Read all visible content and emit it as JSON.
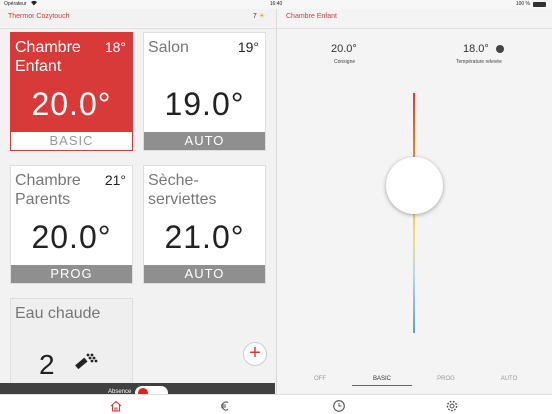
{
  "status": {
    "carrier": "Opérateur",
    "time": "16:40",
    "battery": "100 %"
  },
  "left_nav": {
    "title": "Thermor Cozytouch",
    "weather": "7"
  },
  "tiles": [
    {
      "name": "Chambre Enfant",
      "room_temp": "18°",
      "setpoint": "20.0°",
      "mode": "BASIC"
    },
    {
      "name": "Salon",
      "room_temp": "19°",
      "setpoint": "19.0°",
      "mode": "AUTO"
    },
    {
      "name": "Chambre Parents",
      "room_temp": "21°",
      "setpoint": "20.0°",
      "mode": "PROG"
    },
    {
      "name": "Sèche-serviettes",
      "room_temp": "",
      "setpoint": "21.0°",
      "mode": "AUTO"
    },
    {
      "name": "Eau chaude",
      "value": "2"
    }
  ],
  "add_label": "+",
  "absence": {
    "label": "Absence",
    "enabled": true
  },
  "detail": {
    "title": "Chambre Enfant",
    "consigne_value": "20.0°",
    "consigne_label": "Consigne",
    "measured_value": "18.0°",
    "measured_label": "Température relevée",
    "modes": [
      "OFF",
      "BASIC",
      "PROG",
      "AUTO"
    ],
    "selected_mode": "BASIC"
  },
  "tab_icons": [
    "home-icon",
    "euro-icon",
    "clock-icon",
    "gear-icon"
  ],
  "colors": {
    "accent": "#d83a3a",
    "mode_bar": "#8f8f8f",
    "absence_bar": "#404040"
  }
}
